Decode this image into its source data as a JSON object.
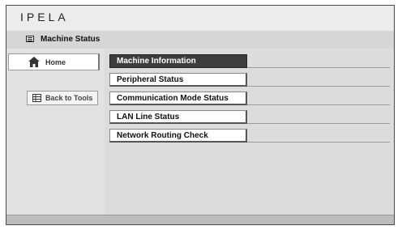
{
  "brand": {
    "logo_text": "IPELA"
  },
  "titlebar": {
    "title": "Machine Status",
    "icon": "machine-status-icon"
  },
  "sidebar": {
    "home_label": "Home",
    "home_icon": "home-icon",
    "back_label": "Back to Tools",
    "back_icon": "grid-icon"
  },
  "menu": {
    "items": [
      {
        "label": "Machine Information",
        "active": true
      },
      {
        "label": "Peripheral Status",
        "active": false
      },
      {
        "label": "Communication Mode Status",
        "active": false
      },
      {
        "label": "LAN Line Status",
        "active": false
      },
      {
        "label": "Network Routing Check",
        "active": false
      }
    ]
  },
  "colors": {
    "active_item_bg": "#3c3c3c",
    "panel_bg": "#dcdcdc",
    "footer_bg": "#bdbdbd"
  }
}
